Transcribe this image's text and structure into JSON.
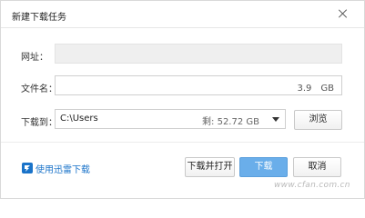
{
  "dialog": {
    "title": "新建下载任务",
    "close_icon": "close-icon"
  },
  "form": {
    "url_label": "网址：",
    "url_value": "",
    "filename_label": "文件名：",
    "filename_value": "",
    "filesize": "3.9　GB",
    "saveto_label": "下载到：",
    "saveto_value": "C:\\Users",
    "free_space": "剩: 52.72 GB",
    "browse_label": "浏览"
  },
  "footer": {
    "thunder_link": "使用迅雷下载",
    "download_open_label": "下载并打开",
    "download_label": "下载",
    "cancel_label": "取消"
  },
  "watermark": "www.cfan.com.cn",
  "colors": {
    "primary": "#6aaeea",
    "link": "#1a73c9"
  }
}
